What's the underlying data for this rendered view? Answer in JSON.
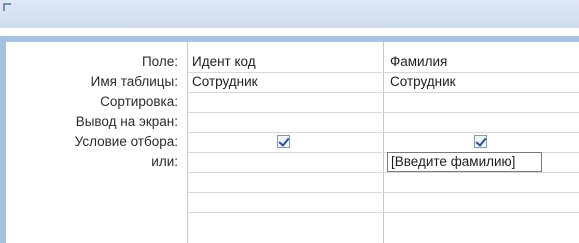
{
  "row_labels": {
    "field": "Поле:",
    "table": "Имя таблицы:",
    "sort": "Сортировка:",
    "show": "Вывод на экран:",
    "criteria": "Условие отбора:",
    "or": "или:"
  },
  "columns": [
    {
      "field": "Идент код",
      "table": "Сотрудник",
      "sort": "",
      "show": true,
      "criteria": ""
    },
    {
      "field": "Фамилия",
      "table": "Сотрудник",
      "sort": "",
      "show": true,
      "criteria": "[Введите фамилию]"
    }
  ],
  "colors": {
    "accent": "#a6c2e2",
    "grid_line": "#c9c9c9"
  }
}
